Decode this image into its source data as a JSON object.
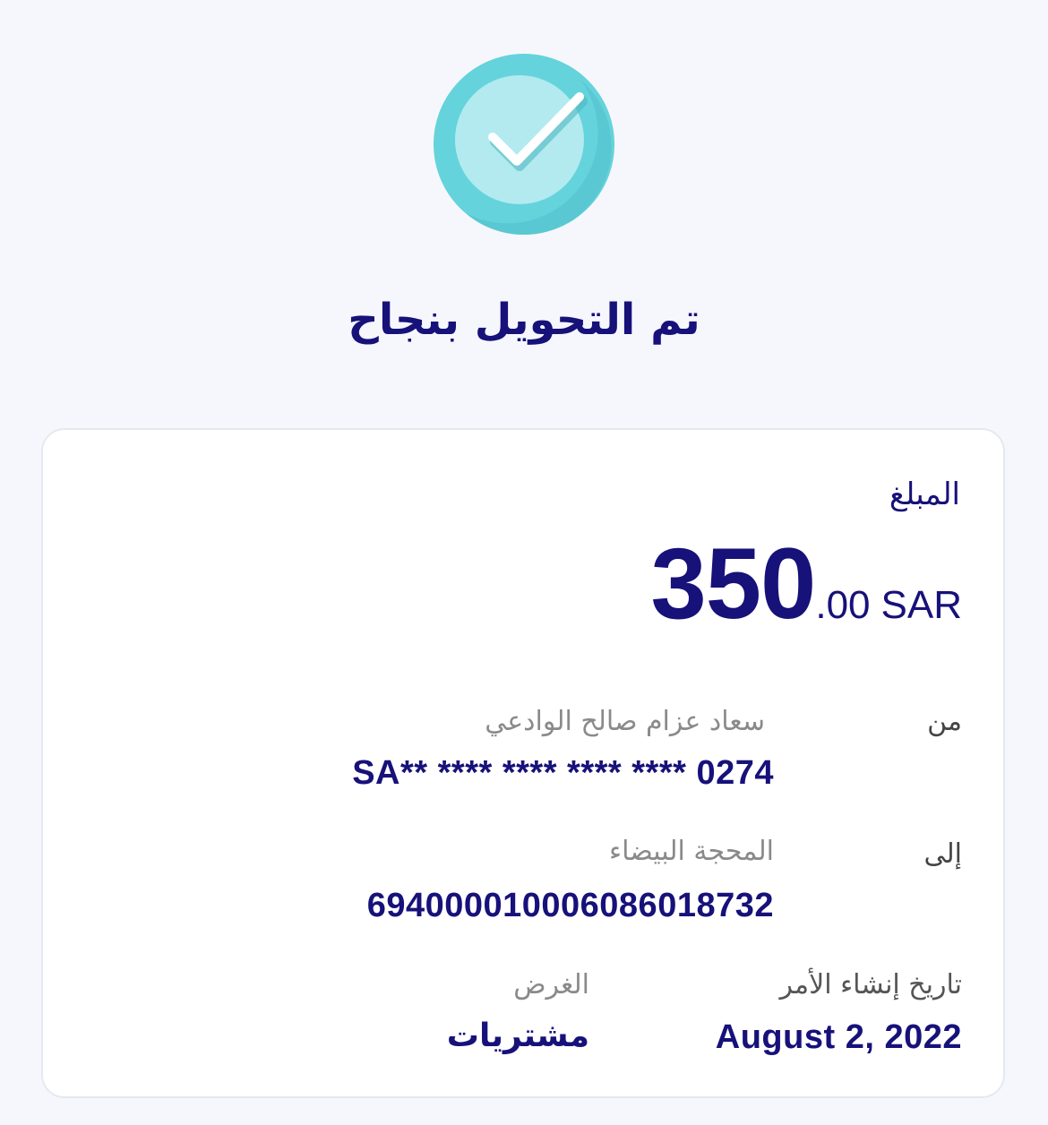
{
  "header": {
    "title": "تم التحويل بنجاح",
    "icon": "check-circle-icon",
    "icon_colors": {
      "outer": "#64d3dc",
      "inner": "#b2eaf0",
      "check": "#ffffff"
    }
  },
  "card": {
    "amount_label": "المبلغ",
    "amount": {
      "integer": "350",
      "decimal": ".00",
      "currency": "SAR"
    },
    "from": {
      "label": "من",
      "name": "سعاد عزام صالح الوادعي",
      "account": "SA** **** **** **** **** 0274"
    },
    "to": {
      "label": "إلى",
      "name": "المحجة البيضاء",
      "account": "69400001000608601873 2"
    },
    "date": {
      "label": "تاريخ إنشاء الأمر",
      "value": "August 2, 2022"
    },
    "purpose": {
      "label": "الغرض",
      "value": "مشتريات"
    }
  },
  "colors": {
    "primary": "#17117a",
    "muted": "#8a8a8a",
    "background": "#f6f7fc",
    "card": "#ffffff",
    "card_border": "#e6e8f0"
  }
}
